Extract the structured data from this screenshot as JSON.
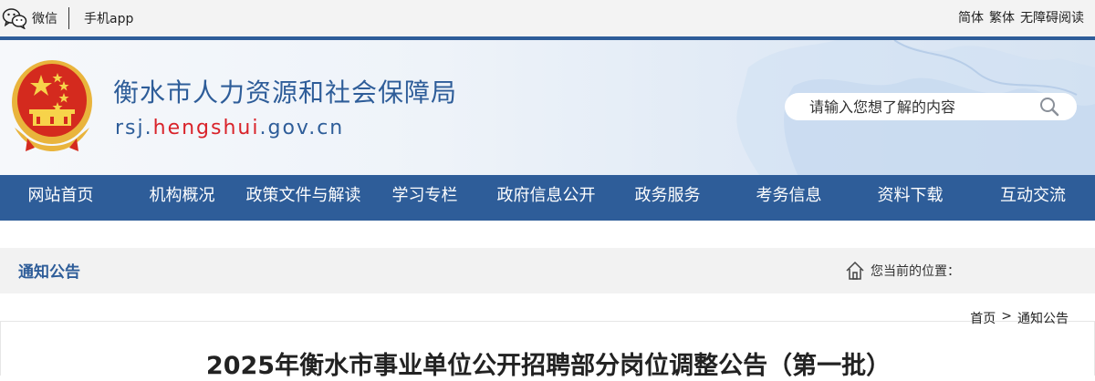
{
  "topbar": {
    "wechat_label": "微信",
    "app_label": "手机app",
    "simplified": "简体",
    "traditional": "繁体",
    "accessible": "无障碍阅读"
  },
  "header": {
    "title": "衡水市人力资源和社会保障局",
    "url_prefix": "rsj.",
    "url_highlight": "hengshui",
    "url_suffix": ".gov.cn",
    "emblem_icon": "national-emblem",
    "search_placeholder": "请输入您想了解的内容",
    "search_icon": "magnifier-icon"
  },
  "colors": {
    "primary": "#2e5d99",
    "accent_red": "#d9232a",
    "emblem_gold": "#e9b43c",
    "emblem_red": "#d42a1e"
  },
  "nav": {
    "items": [
      {
        "label": "网站首页"
      },
      {
        "label": "机构概况"
      },
      {
        "label": "政策文件与解读"
      },
      {
        "label": "学习专栏"
      },
      {
        "label": "政府信息公开"
      },
      {
        "label": "政务服务"
      },
      {
        "label": "考务信息"
      },
      {
        "label": "资料下载"
      },
      {
        "label": "互动交流"
      }
    ]
  },
  "section": {
    "title": "通知公告",
    "location_label": "您当前的位置：",
    "home_icon": "home-icon"
  },
  "breadcrumb": {
    "home": "首页",
    "separator": ">",
    "current": "通知公告"
  },
  "article": {
    "title": "2025年衡水市事业单位公开招聘部分岗位调整公告（第一批）"
  }
}
